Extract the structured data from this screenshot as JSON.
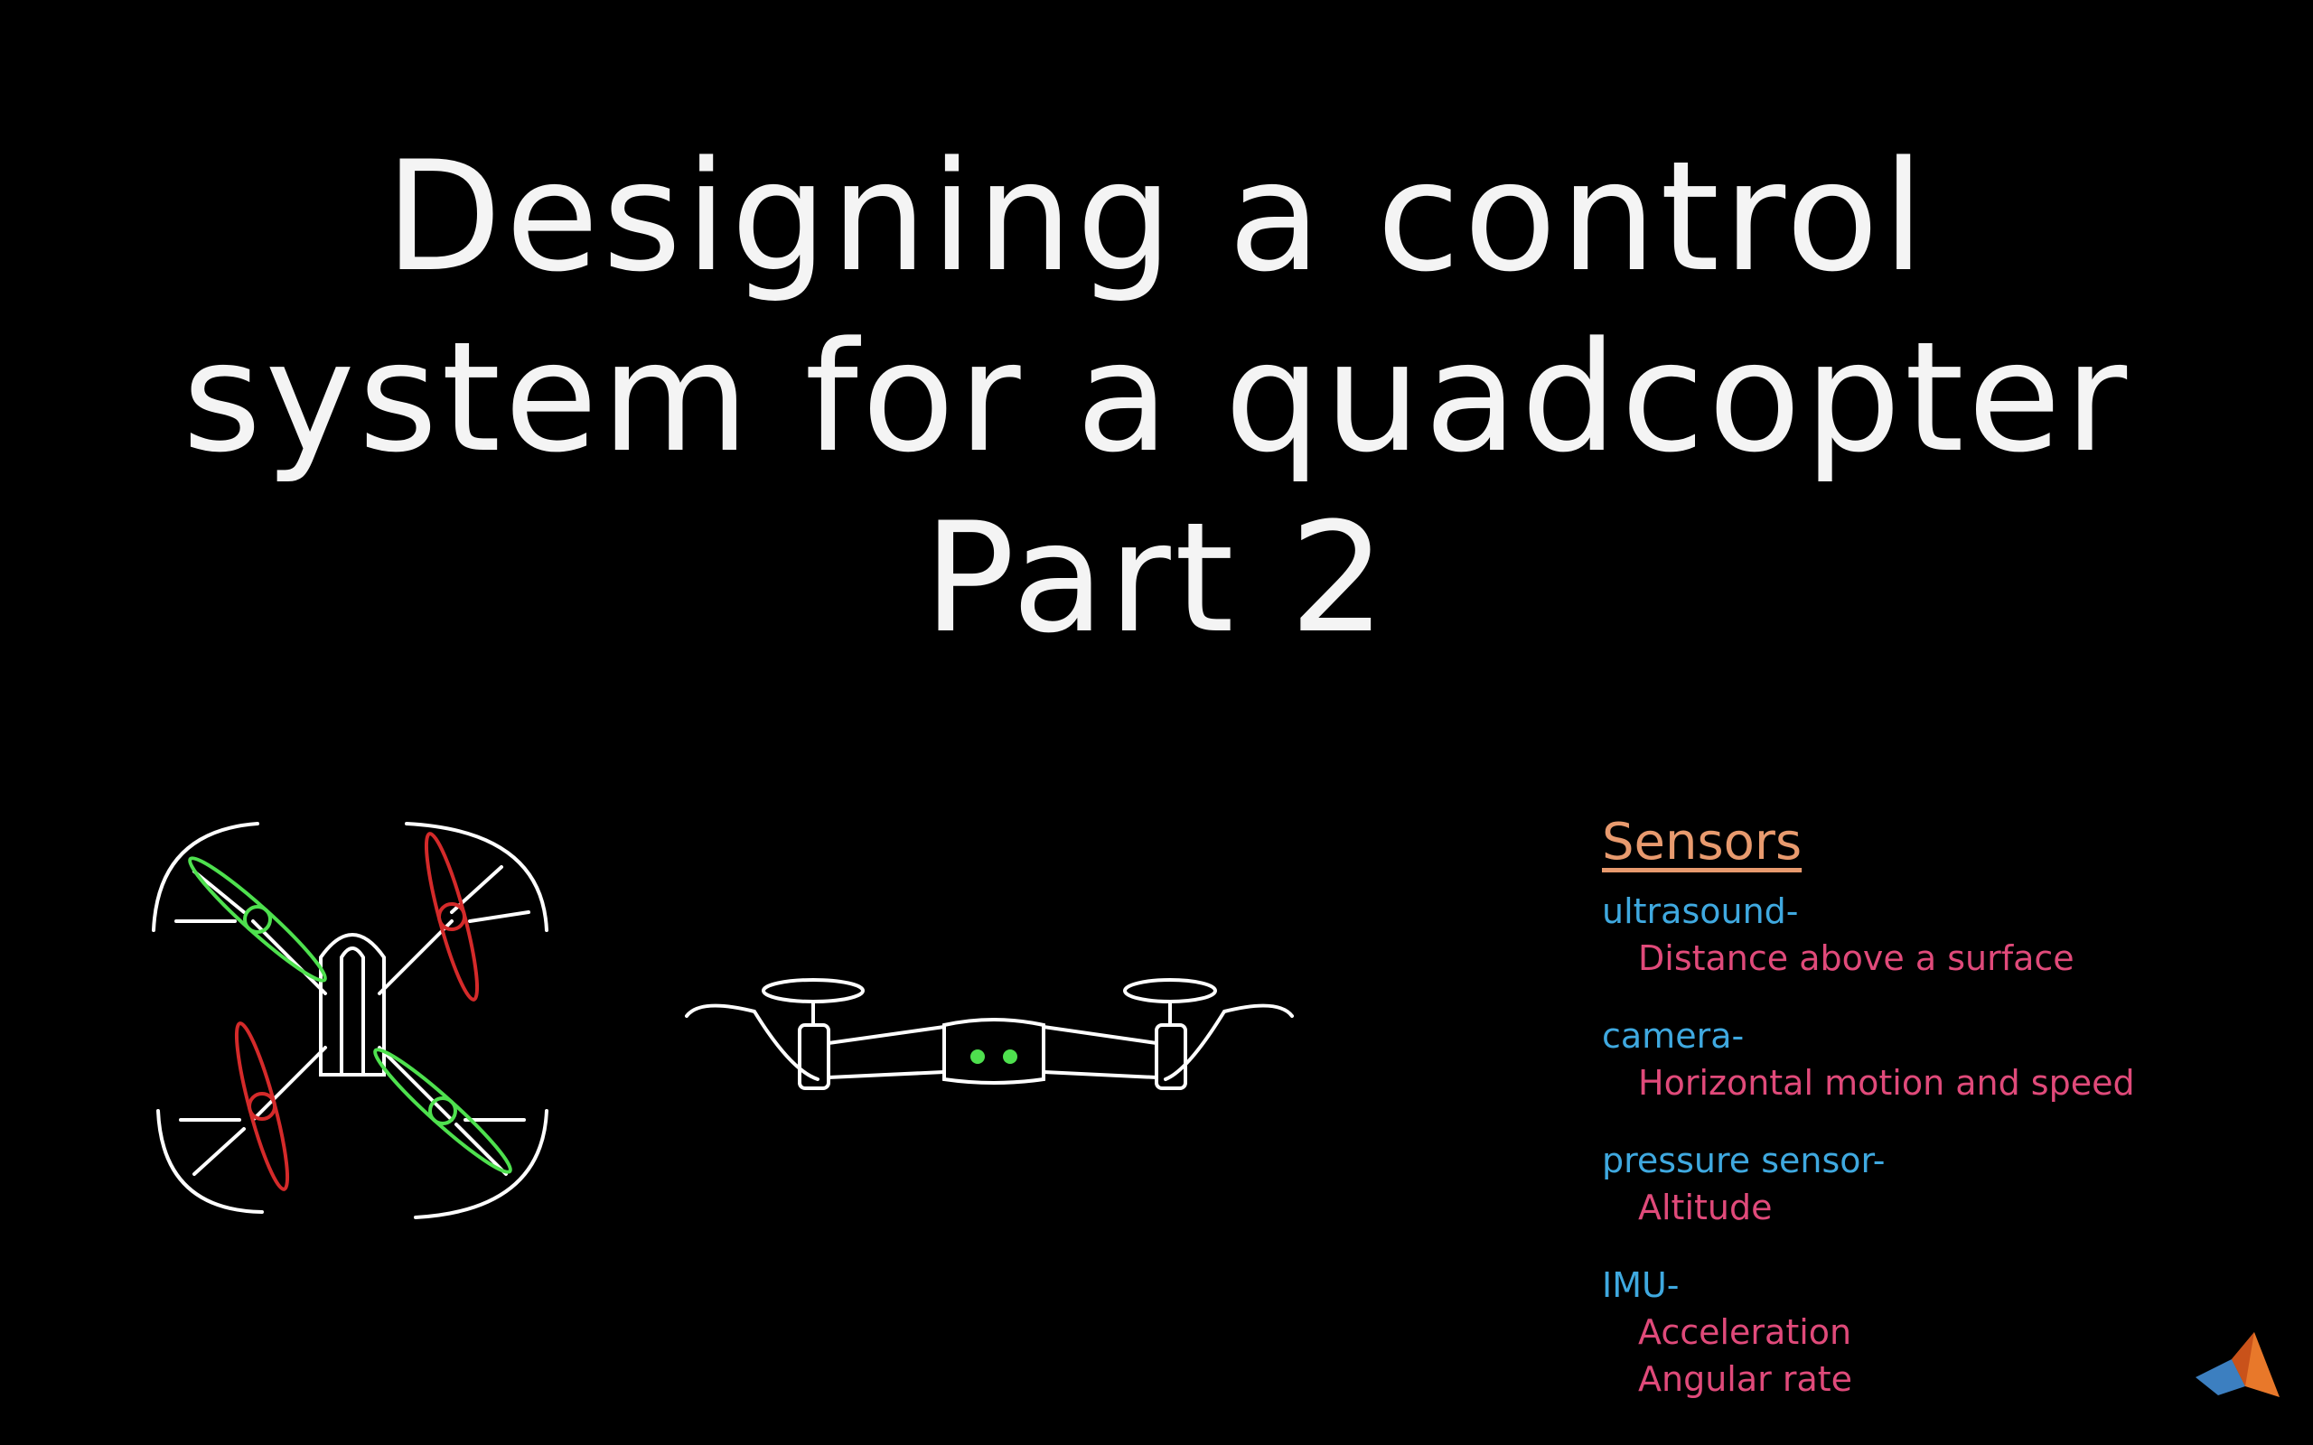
{
  "title": {
    "line1": "Designing a control",
    "line2": "system for a quadcopter",
    "line3": "Part 2"
  },
  "sensors": {
    "heading": "Sensors",
    "items": [
      {
        "name": "ultrasound-",
        "details": [
          "Distance above a surface"
        ]
      },
      {
        "name": "camera-",
        "details": [
          "Horizontal motion and speed"
        ]
      },
      {
        "name": "pressure sensor-",
        "details": [
          "Altitude"
        ]
      },
      {
        "name": "IMU-",
        "details": [
          "Acceleration",
          "Angular rate"
        ]
      }
    ]
  },
  "colors": {
    "background": "#000000",
    "line": "#ffffff",
    "prop_green": "#4ee04e",
    "prop_red": "#d42a2a",
    "heading": "#e89a6e",
    "sensor_name": "#3fa9e0",
    "sensor_desc": "#e04a7a"
  },
  "icons": {
    "logo": "matlab-logo-icon"
  }
}
